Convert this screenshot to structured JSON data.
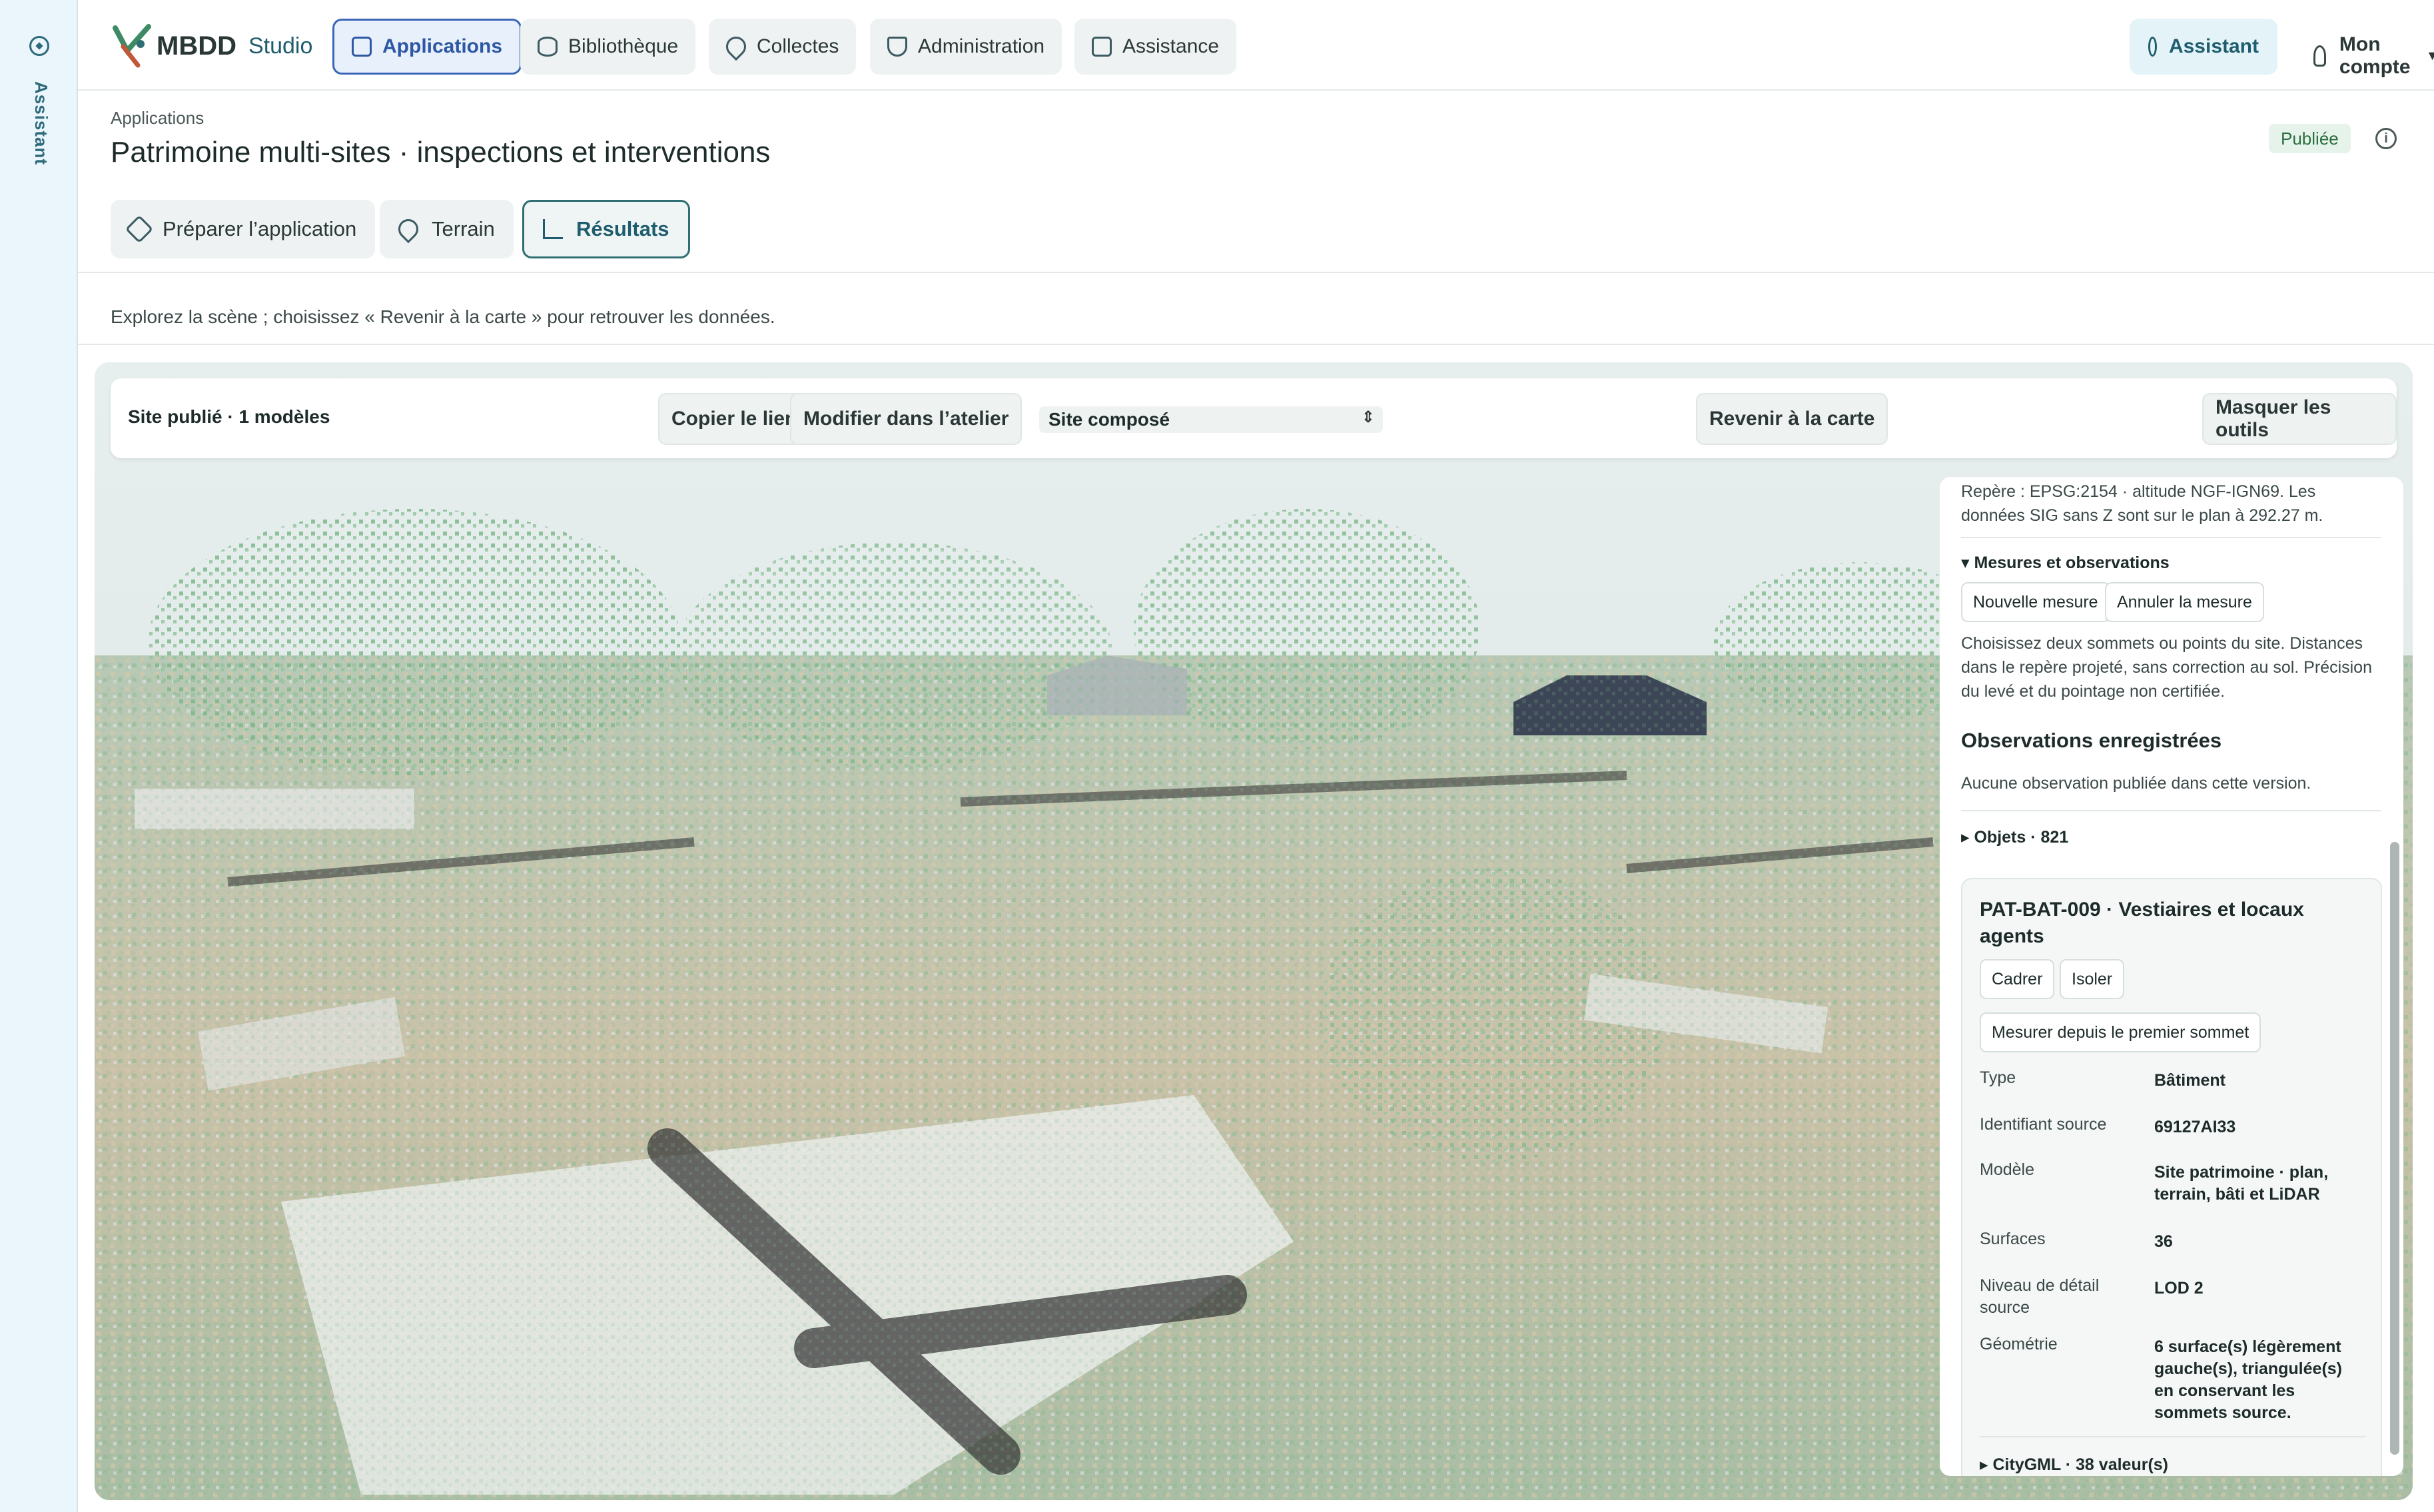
{
  "rail": {
    "label": "Assistant",
    "icon": "compass-icon"
  },
  "brand": {
    "name": "MBDD",
    "product": "Studio",
    "accent": "#2f7a5a"
  },
  "nav": {
    "tabs": [
      {
        "label": "Applications",
        "icon": "grid-icon",
        "active": true
      },
      {
        "label": "Bibliothèque",
        "icon": "database-icon",
        "active": false
      },
      {
        "label": "Collectes",
        "icon": "pin-icon",
        "active": false
      },
      {
        "label": "Administration",
        "icon": "shield-icon",
        "active": false
      },
      {
        "label": "Assistance",
        "icon": "message-icon",
        "active": false
      }
    ],
    "assistant_label": "Assistant",
    "account_label": "Mon compte"
  },
  "page": {
    "breadcrumb": "Applications",
    "title": "Patrimoine multi-sites · inspections et interventions",
    "status": "Publiée",
    "subtabs": [
      {
        "label": "Préparer l’application",
        "icon": "layers-icon",
        "active": false
      },
      {
        "label": "Terrain",
        "icon": "pin-icon",
        "active": false
      },
      {
        "label": "Résultats",
        "icon": "bar-chart-icon",
        "active": true
      }
    ],
    "hint": "Explorez la scène ; choisissez « Revenir à la carte » pour retrouver les données."
  },
  "viewer": {
    "site_label": "Site publié · 1 modèles",
    "copy_link": "Copier le lien",
    "edit_workshop": "Modifier dans l’atelier",
    "select_value": "Site composé",
    "back_to_map": "Revenir à la carte",
    "hide_tools": "Masquer les outils"
  },
  "panel": {
    "reference": "Repère : EPSG:2154 · altitude NGF-IGN69. Les données SIG sans Z sont sur le plan à 292.27 m.",
    "measures_section": "▾ Mesures et observations",
    "new_measure": "Nouvelle mesure",
    "cancel_measure": "Annuler la mesure",
    "measures_hint": "Choisissez deux sommets ou points du site. Distances dans le repère projeté, sans correction au sol. Précision du levé et du pointage non certifiée.",
    "observations_heading": "Observations enregistrées",
    "observations_empty": "Aucune observation publiée dans cette version.",
    "objects_section": "▸ Objets · 821",
    "object": {
      "title": "PAT-BAT-009 · Vestiaires et locaux agents",
      "frame": "Cadrer",
      "isolate": "Isoler",
      "measure_from_vertex": "Mesurer depuis le premier sommet",
      "attributes": [
        {
          "label": "Type",
          "value": "Bâtiment"
        },
        {
          "label": "Identifiant source",
          "value": "69127AI33"
        },
        {
          "label": "Modèle",
          "value": "Site patrimoine · plan, terrain, bâti et LiDAR"
        },
        {
          "label": "Surfaces",
          "value": "36"
        },
        {
          "label": "Niveau de détail source",
          "value": "LOD 2"
        },
        {
          "label": "Géométrie",
          "value": "6 surface(s) légèrement gauche(s), triangulée(s) en conservant les sommets source."
        }
      ],
      "citygml_section": "▸ CityGML · 38 valeur(s)"
    }
  }
}
